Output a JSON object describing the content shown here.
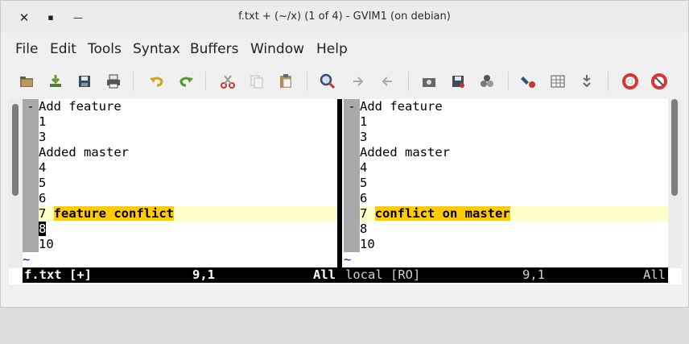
{
  "window": {
    "title": "f.txt + (~/x) (1 of 4) - GVIM1 (on debian)",
    "close_glyph": "✕",
    "maximize_glyph": "▪",
    "minimize_glyph": "—"
  },
  "menu": [
    "File",
    "Edit",
    "Tools",
    "Syntax",
    "Buffers",
    "Window",
    "Help"
  ],
  "toolbar": [
    "open-icon",
    "save-as-icon",
    "save-icon",
    "print-icon",
    "undo-icon",
    "redo-icon",
    "cut-icon",
    "copy-icon",
    "paste-icon",
    "find-replace-icon",
    "find-next-icon",
    "find-prev-icon",
    "load-session-icon",
    "save-session-icon",
    "run-script-icon",
    "make-icon",
    "shell-icon",
    "ctags-icon",
    "help-icon",
    "find-help-icon"
  ],
  "left_pane": {
    "fold_marker": "-",
    "lines": [
      "Add feature",
      "1",
      "3",
      "Added master",
      "4",
      "5",
      "6",
      "7 ",
      "8",
      "10"
    ],
    "change_line_prefix": "7 ",
    "change_text": "feature conflict",
    "cursor_char": "8",
    "tilde": "~",
    "status": {
      "name": "f.txt [+]",
      "pos": "9,1",
      "scroll": "All"
    }
  },
  "right_pane": {
    "fold_marker": "-",
    "lines": [
      "Add feature",
      "1",
      "3",
      "Added master",
      "4",
      "5",
      "6",
      "7 ",
      "8",
      "10"
    ],
    "change_line_prefix": "7 ",
    "change_text": "conflict on master",
    "tilde": "~",
    "status": {
      "name": "local [RO]",
      "pos": "9,1",
      "scroll": "All"
    }
  },
  "colors": {
    "diff_change": "#ffffc8",
    "diff_text": "#ffcc00",
    "fold_column": "#a9a9a9",
    "statusline": "#000000"
  }
}
